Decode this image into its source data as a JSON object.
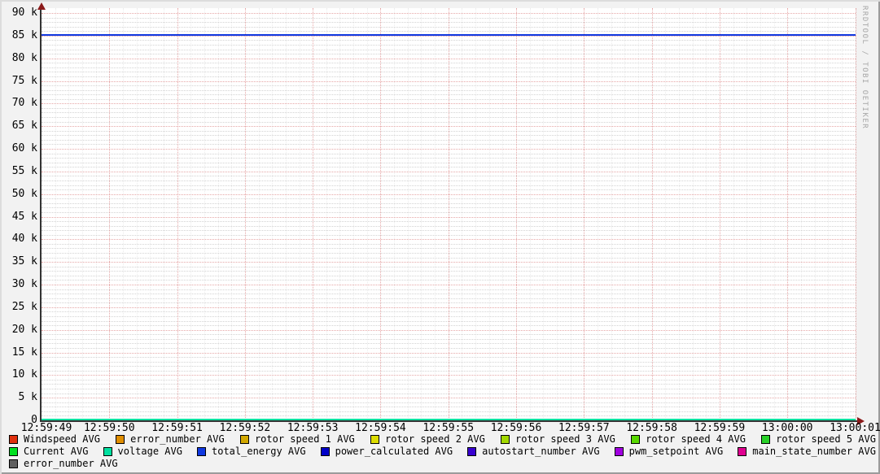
{
  "watermark": "RRDTOOL / TOBI OETIKER",
  "palette": {
    "background": "#F2F2F2",
    "canvas": "#FFFFFF",
    "axis": "#333333",
    "arrow": "#8B1A1A",
    "grid_minor": "rgba(130,130,130,0.35)",
    "grid_major": "rgba(200,60,60,0.45)",
    "text": "#000000",
    "watermark_text": "#A6A6A6"
  },
  "chart_data": {
    "type": "line",
    "title": "",
    "x_ticks": [
      "12:59:49",
      "12:59:50",
      "12:59:51",
      "12:59:52",
      "12:59:53",
      "12:59:54",
      "12:59:55",
      "12:59:56",
      "12:59:57",
      "12:59:58",
      "12:59:59",
      "13:00:00",
      "13:00:01"
    ],
    "y_tick_values": [
      0,
      5000,
      10000,
      15000,
      20000,
      25000,
      30000,
      35000,
      40000,
      45000,
      50000,
      55000,
      60000,
      65000,
      70000,
      75000,
      80000,
      85000,
      90000
    ],
    "y_tick_labels": [
      "0",
      "5 k",
      "10 k",
      "15 k",
      "20 k",
      "25 k",
      "30 k",
      "35 k",
      "40 k",
      "45 k",
      "50 k",
      "55 k",
      "60 k",
      "65 k",
      "70 k",
      "75 k",
      "80 k",
      "85 k",
      "90 k"
    ],
    "ylim": [
      0,
      90000
    ],
    "y_minor_step": 1000,
    "x_minor_per_major": 5,
    "grid": true,
    "legend_position": "bottom",
    "series": [
      {
        "name": "Windspeed AVG",
        "color": "#E0300E",
        "value": null
      },
      {
        "name": "error_number AVG",
        "color": "#E08E00",
        "value": null
      },
      {
        "name": "rotor speed 1 AVG",
        "color": "#D2A800",
        "value": null
      },
      {
        "name": "rotor speed 2 AVG",
        "color": "#DCDC00",
        "value": null
      },
      {
        "name": "rotor speed 3 AVG",
        "color": "#A2D800",
        "value": null
      },
      {
        "name": "rotor speed 4 AVG",
        "color": "#58D800",
        "value": null
      },
      {
        "name": "rotor speed 5 AVG",
        "color": "#28D028",
        "value": null
      },
      {
        "name": "Current AVG",
        "color": "#00E020",
        "value": null
      },
      {
        "name": "voltage AVG",
        "color": "#00E0A0",
        "value": 0
      },
      {
        "name": "total_energy AVG",
        "color": "#1038E0",
        "value": 85000
      },
      {
        "name": "power_calculated AVG",
        "color": "#0000C8",
        "value": null
      },
      {
        "name": "autostart_number AVG",
        "color": "#3800D0",
        "value": null
      },
      {
        "name": "pwm_setpoint AVG",
        "color": "#A000E0",
        "value": null
      },
      {
        "name": "main_state_number AVG",
        "color": "#E00090",
        "value": null
      },
      {
        "name": "error_number AVG",
        "color": "#606060",
        "value": null
      }
    ],
    "legend_rows": [
      [
        0,
        1,
        2,
        3,
        4,
        5,
        6
      ],
      [
        7,
        8,
        9,
        10,
        11,
        12,
        13
      ],
      [
        14
      ]
    ]
  }
}
